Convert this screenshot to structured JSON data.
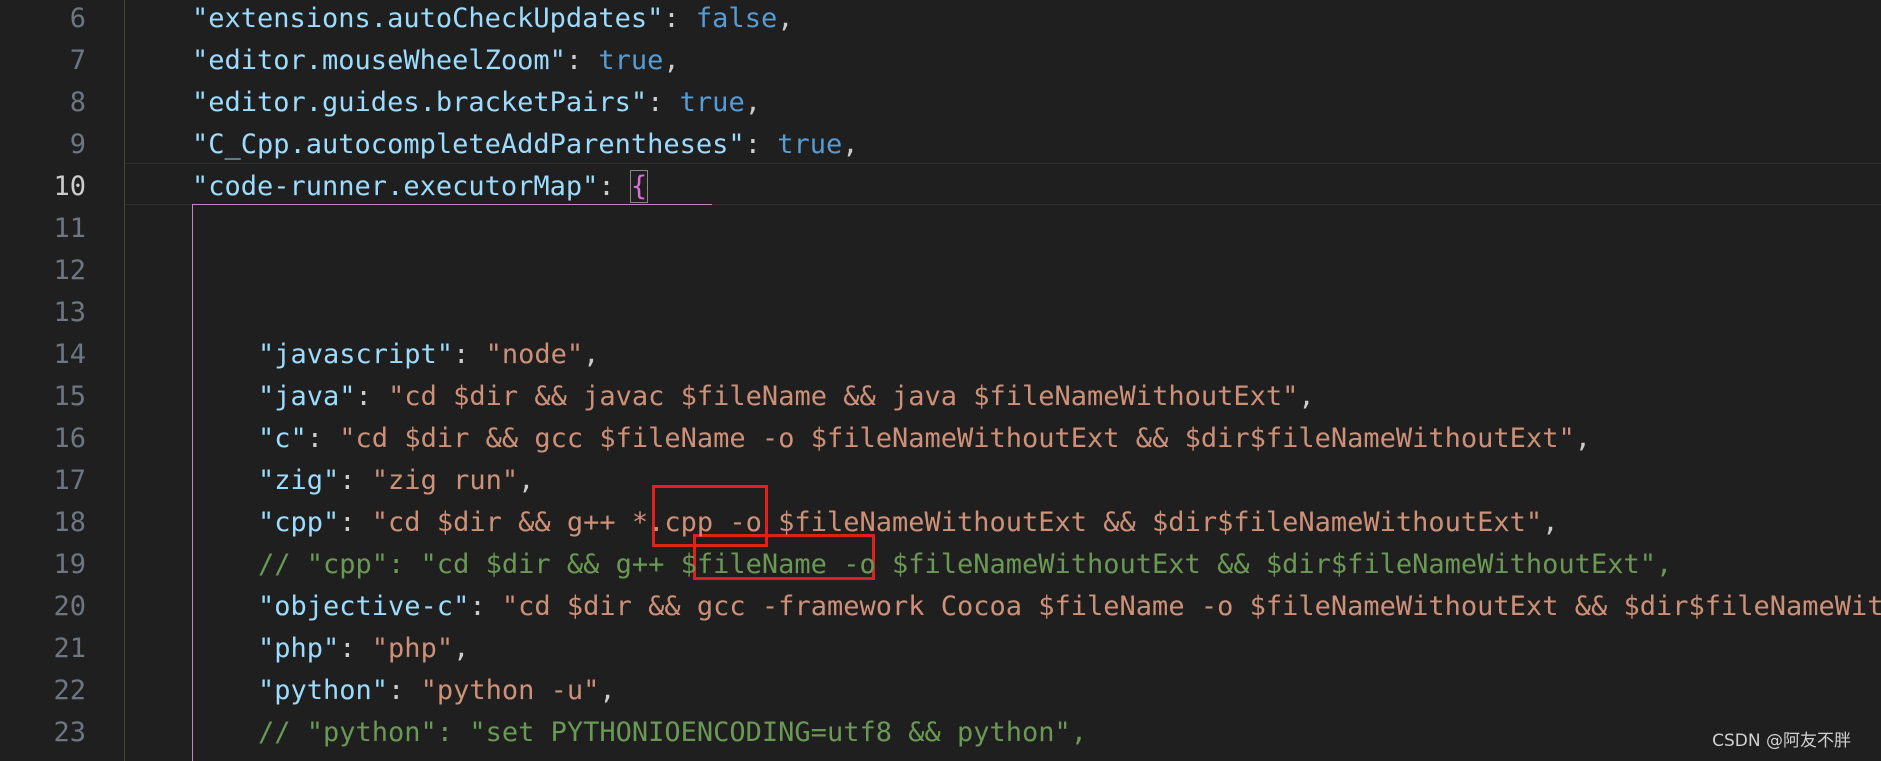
{
  "editor": {
    "active_line": "10",
    "line_numbers": [
      "6",
      "7",
      "8",
      "9",
      "10",
      "11",
      "12",
      "13",
      "14",
      "15",
      "16",
      "17",
      "18",
      "19",
      "20",
      "21",
      "22",
      "23"
    ],
    "lines": [
      {
        "indent": "    ",
        "segments": [
          {
            "t": "\"extensions.autoCheckUpdates\"",
            "c": "k"
          },
          {
            "t": ": ",
            "c": "p"
          },
          {
            "t": "false",
            "c": "b"
          },
          {
            "t": ",",
            "c": "p"
          }
        ]
      },
      {
        "indent": "    ",
        "segments": [
          {
            "t": "\"editor.mouseWheelZoom\"",
            "c": "k"
          },
          {
            "t": ": ",
            "c": "p"
          },
          {
            "t": "true",
            "c": "b"
          },
          {
            "t": ",",
            "c": "p"
          }
        ]
      },
      {
        "indent": "    ",
        "segments": [
          {
            "t": "\"editor.guides.bracketPairs\"",
            "c": "k"
          },
          {
            "t": ": ",
            "c": "p"
          },
          {
            "t": "true",
            "c": "b"
          },
          {
            "t": ",",
            "c": "p"
          }
        ]
      },
      {
        "indent": "    ",
        "segments": [
          {
            "t": "\"C_Cpp.autocompleteAddParentheses\"",
            "c": "k"
          },
          {
            "t": ": ",
            "c": "p"
          },
          {
            "t": "true",
            "c": "b"
          },
          {
            "t": ",",
            "c": "p"
          }
        ]
      },
      {
        "indent": "    ",
        "segments": [
          {
            "t": "\"code-runner.executorMap\"",
            "c": "k"
          },
          {
            "t": ": ",
            "c": "p"
          },
          {
            "t": "{",
            "c": "br",
            "cursor": true
          }
        ]
      },
      {
        "indent": "",
        "segments": []
      },
      {
        "indent": "",
        "segments": []
      },
      {
        "indent": "",
        "segments": []
      },
      {
        "indent": "        ",
        "segments": [
          {
            "t": "\"javascript\"",
            "c": "k"
          },
          {
            "t": ": ",
            "c": "p"
          },
          {
            "t": "\"node\"",
            "c": "s"
          },
          {
            "t": ",",
            "c": "p"
          }
        ]
      },
      {
        "indent": "        ",
        "segments": [
          {
            "t": "\"java\"",
            "c": "k"
          },
          {
            "t": ": ",
            "c": "p"
          },
          {
            "t": "\"cd $dir && javac $fileName && java $fileNameWithoutExt\"",
            "c": "s"
          },
          {
            "t": ",",
            "c": "p"
          }
        ]
      },
      {
        "indent": "        ",
        "segments": [
          {
            "t": "\"c\"",
            "c": "k"
          },
          {
            "t": ": ",
            "c": "p"
          },
          {
            "t": "\"cd $dir && gcc $fileName -o $fileNameWithoutExt && $dir$fileNameWithoutExt\"",
            "c": "s"
          },
          {
            "t": ",",
            "c": "p"
          }
        ]
      },
      {
        "indent": "        ",
        "segments": [
          {
            "t": "\"zig\"",
            "c": "k"
          },
          {
            "t": ": ",
            "c": "p"
          },
          {
            "t": "\"zig run\"",
            "c": "s"
          },
          {
            "t": ",",
            "c": "p"
          }
        ]
      },
      {
        "indent": "        ",
        "segments": [
          {
            "t": "\"cpp\"",
            "c": "k"
          },
          {
            "t": ": ",
            "c": "p"
          },
          {
            "t": "\"cd $dir && g++ *.cpp -o $fileNameWithoutExt && $dir$fileNameWithoutExt\"",
            "c": "s"
          },
          {
            "t": ",",
            "c": "p"
          }
        ]
      },
      {
        "indent": "        ",
        "segments": [
          {
            "t": "// \"cpp\": \"cd $dir && g++ $fileName -o $fileNameWithoutExt && $dir$fileNameWithoutExt\",",
            "c": "c"
          }
        ]
      },
      {
        "indent": "        ",
        "segments": [
          {
            "t": "\"objective-c\"",
            "c": "k"
          },
          {
            "t": ": ",
            "c": "p"
          },
          {
            "t": "\"cd $dir && gcc -framework Cocoa $fileName -o $fileNameWithoutExt && $dir$fileNameWithoutExt\"",
            "c": "s"
          },
          {
            "t": ",",
            "c": "p"
          }
        ]
      },
      {
        "indent": "        ",
        "segments": [
          {
            "t": "\"php\"",
            "c": "k"
          },
          {
            "t": ": ",
            "c": "p"
          },
          {
            "t": "\"php\"",
            "c": "s"
          },
          {
            "t": ",",
            "c": "p"
          }
        ]
      },
      {
        "indent": "        ",
        "segments": [
          {
            "t": "\"python\"",
            "c": "k"
          },
          {
            "t": ": ",
            "c": "p"
          },
          {
            "t": "\"python -u\"",
            "c": "s"
          },
          {
            "t": ",",
            "c": "p"
          }
        ]
      },
      {
        "indent": "        ",
        "segments": [
          {
            "t": "// \"python\": \"set PYTHONIOENCODING=utf8 && python\",",
            "c": "c"
          }
        ]
      }
    ]
  },
  "colors": {
    "background": "#1f1f1f",
    "property_key": "#9cdcfe",
    "string": "#ce9178",
    "boolean": "#569cd6",
    "comment": "#6a9955",
    "bracket": "#da70d6",
    "highlight_box": "#e0201a"
  },
  "watermark": "CSDN @阿友不胖"
}
